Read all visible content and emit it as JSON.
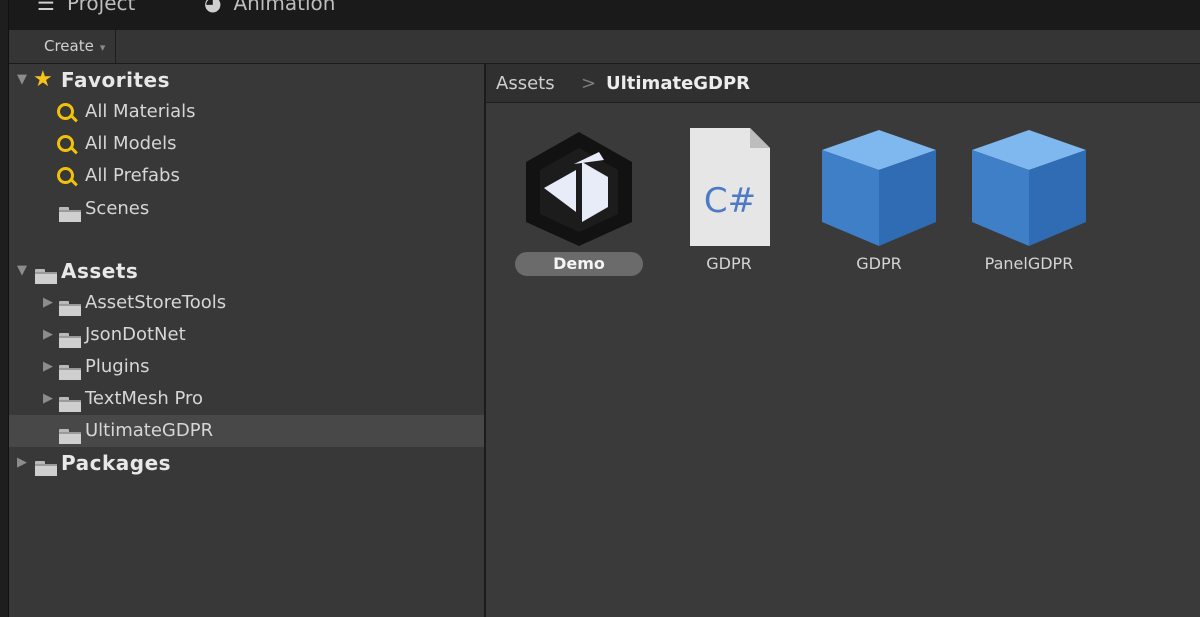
{
  "tabs": [
    {
      "label": "Project",
      "icon": "list-icon"
    },
    {
      "label": "Animation",
      "icon": "clock-icon"
    }
  ],
  "toolbar": {
    "create_label": "Create",
    "create_caret": "▾"
  },
  "tree": {
    "favorites": {
      "label": "Favorites",
      "items": [
        {
          "label": "All Materials",
          "icon": "search-icon"
        },
        {
          "label": "All Models",
          "icon": "search-icon"
        },
        {
          "label": "All Prefabs",
          "icon": "search-icon"
        },
        {
          "label": "Scenes",
          "icon": "scene-folder-icon"
        }
      ]
    },
    "assets": {
      "label": "Assets",
      "items": [
        {
          "label": "AssetStoreTools"
        },
        {
          "label": "JsonDotNet"
        },
        {
          "label": "Plugins"
        },
        {
          "label": "TextMesh Pro"
        },
        {
          "label": "UltimateGDPR",
          "selected": true
        }
      ]
    },
    "packages": {
      "label": "Packages"
    }
  },
  "breadcrumb": {
    "root": "Assets",
    "separator": ">",
    "current": "UltimateGDPR"
  },
  "assets": [
    {
      "name": "Demo",
      "icon": "unity-scene-icon",
      "selected": true
    },
    {
      "name": "GDPR",
      "icon": "csharp-script-icon",
      "icon_text": "C#"
    },
    {
      "name": "GDPR",
      "icon": "prefab-cube-icon"
    },
    {
      "name": "PanelGDPR",
      "icon": "prefab-cube-icon"
    }
  ],
  "colors": {
    "accent_search": "#f2c10a",
    "star": "#f7c21a",
    "cube": "#4a8fd6",
    "background": "#3a3a3a"
  }
}
